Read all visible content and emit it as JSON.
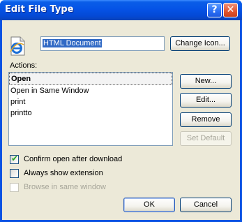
{
  "window": {
    "title": "Edit File Type"
  },
  "titlebar": {
    "help_label": "?",
    "close_label": "✕"
  },
  "file_type": {
    "name_value": "HTML Document",
    "change_icon_label": "Change Icon..."
  },
  "actions": {
    "label": "Actions:",
    "items": [
      "Open",
      "Open in Same Window",
      "print",
      "printto"
    ],
    "buttons": {
      "new": "New...",
      "edit": "Edit...",
      "remove": "Remove",
      "set_default": "Set Default"
    }
  },
  "options": {
    "confirm_open": {
      "label": "Confirm open after download",
      "checked": true
    },
    "always_show_ext": {
      "label": "Always show extension",
      "checked": false
    },
    "browse_same_window": {
      "label": "Browse in same window",
      "checked": false,
      "disabled": true
    }
  },
  "footer": {
    "ok_label": "OK",
    "cancel_label": "Cancel"
  },
  "colors": {
    "title_bar": "#0553e6",
    "selection": "#316ac5",
    "dialog_bg": "#ece9d8"
  }
}
